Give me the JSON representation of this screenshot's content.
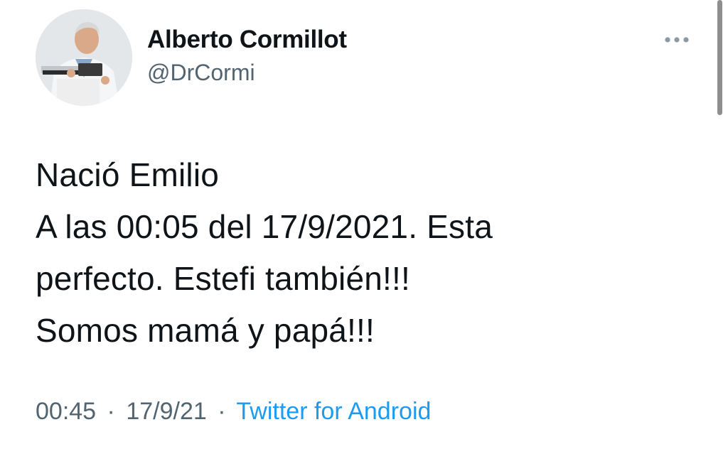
{
  "author": {
    "display_name": "Alberto Cormillot",
    "handle": "@DrCormi",
    "avatar_icon": "doctor-with-scale-photo"
  },
  "more_icon": "more-horizontal-icon",
  "tweet": {
    "lines": [
      "Nació Emilio",
      "A las 00:05 del 17/9/2021. Esta",
      "perfecto. Estefi también!!!",
      "Somos mamá y papá!!!"
    ]
  },
  "meta": {
    "time": "00:45",
    "separator": "·",
    "date": "17/9/21",
    "source": "Twitter for Android"
  },
  "colors": {
    "text": "#0f1419",
    "secondary": "#536471",
    "link": "#1d9bf0"
  }
}
